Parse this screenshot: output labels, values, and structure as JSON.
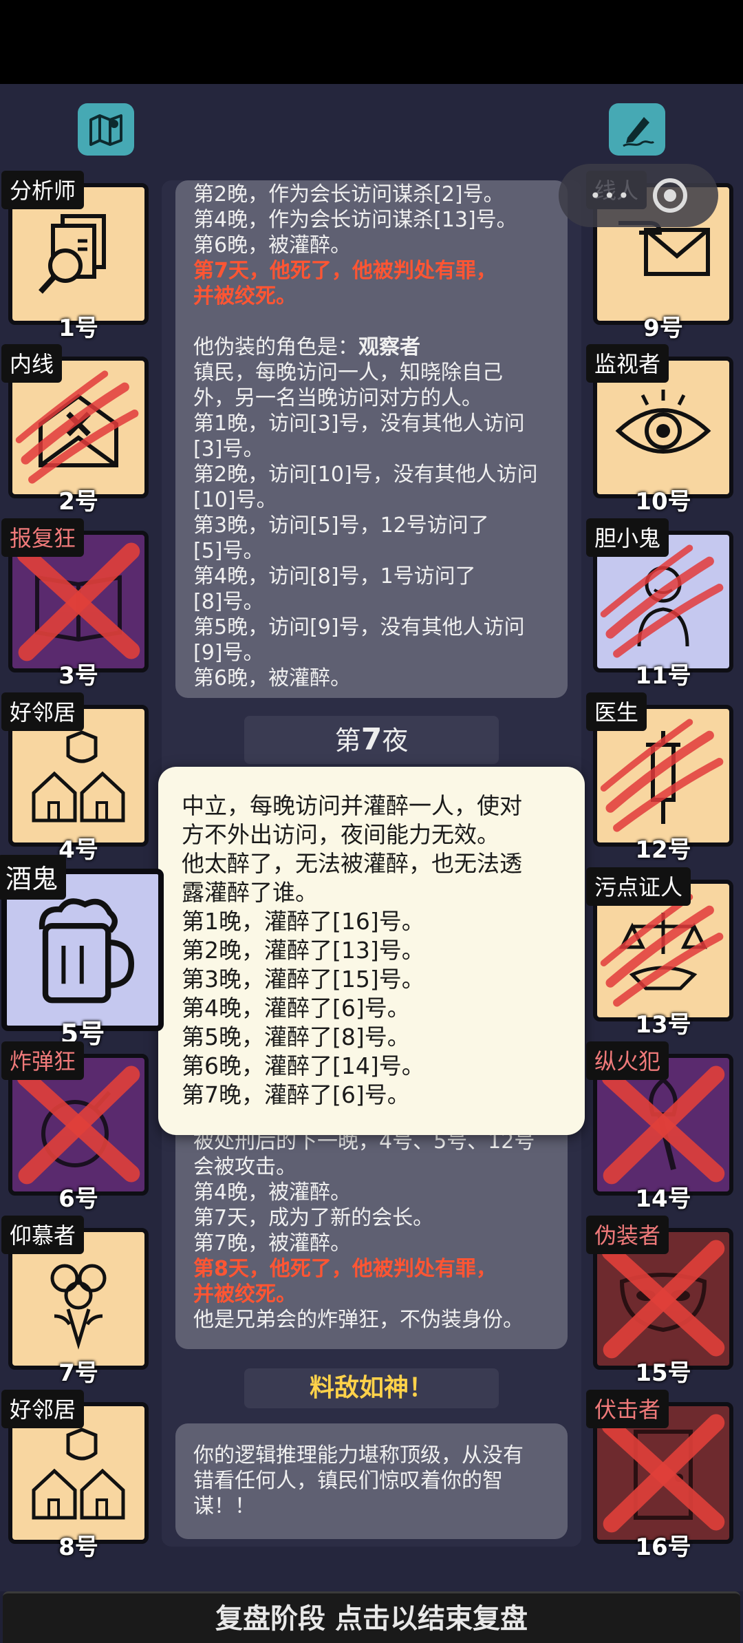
{
  "top_buttons": {
    "map_icon": "map-icon",
    "edit_icon": "notes-edit-icon"
  },
  "players": [
    {
      "num": "1号",
      "role": "分析师",
      "dead": false,
      "bg": "cream",
      "icon": "magnifier-documents-icon"
    },
    {
      "num": "2号",
      "role": "内线",
      "dead": false,
      "bg": "cream",
      "icon": "envelope-x-icon",
      "attacked": true
    },
    {
      "num": "3号",
      "role": "报复狂",
      "dead": true,
      "bg": "purple",
      "icon": "book-icon"
    },
    {
      "num": "4号",
      "role": "好邻居",
      "dead": false,
      "bg": "cream",
      "icon": "houses-shield-icon"
    },
    {
      "num": "5号",
      "role": "酒鬼",
      "dead": false,
      "bg": "lavender",
      "icon": "beer-mug-icon",
      "selected": true
    },
    {
      "num": "6号",
      "role": "炸弹狂",
      "dead": true,
      "bg": "purple",
      "icon": "bomb-icon"
    },
    {
      "num": "7号",
      "role": "仰慕者",
      "dead": false,
      "bg": "cream",
      "icon": "roses-icon"
    },
    {
      "num": "8号",
      "role": "好邻居",
      "dead": false,
      "bg": "cream",
      "icon": "houses-shield-icon"
    },
    {
      "num": "9号",
      "role": "线人",
      "dead": false,
      "bg": "cream",
      "icon": "hand-envelope-icon"
    },
    {
      "num": "10号",
      "role": "监视者",
      "dead": false,
      "bg": "cream",
      "icon": "eye-icon"
    },
    {
      "num": "11号",
      "role": "胆小鬼",
      "dead": false,
      "bg": "lavender",
      "icon": "scared-person-icon",
      "attacked": true
    },
    {
      "num": "12号",
      "role": "医生",
      "dead": false,
      "bg": "cream",
      "icon": "syringe-icon",
      "attacked": true
    },
    {
      "num": "13号",
      "role": "污点证人",
      "dead": false,
      "bg": "cream",
      "icon": "scales-handshake-icon",
      "attacked": true
    },
    {
      "num": "14号",
      "role": "纵火犯",
      "dead": true,
      "bg": "purple",
      "icon": "torch-icon"
    },
    {
      "num": "15号",
      "role": "伪装者",
      "dead": true,
      "bg": "maroon",
      "icon": "mask-icon"
    },
    {
      "num": "16号",
      "role": "伏击者",
      "dead": true,
      "bg": "maroon",
      "icon": "door-icon"
    }
  ],
  "pill": {
    "more_icon": "more-dots-icon",
    "close_icon": "target-close-icon"
  },
  "upper_log": {
    "lines": [
      {
        "text": "第2晚，作为会长访问谋杀[2]号。",
        "style": "normal"
      },
      {
        "text": "第4晚，作为会长访问谋杀[13]号。",
        "style": "normal"
      },
      {
        "text": "第6晚，被灌醉。",
        "style": "normal"
      },
      {
        "text": "第7天，他死了，他被判处有罪，",
        "style": "red"
      },
      {
        "text": "并被绞死。",
        "style": "red"
      },
      {
        "text": "",
        "style": "normal"
      },
      {
        "text": "他伪装的角色是：",
        "style": "normal",
        "bold_suffix": "观察者"
      },
      {
        "text": "镇民，每晚访问一人，知晓除自己",
        "style": "normal"
      },
      {
        "text": "外，另一名当晚访问对方的人。",
        "style": "normal"
      },
      {
        "text": "第1晚，访问[3]号，没有其他人访问",
        "style": "normal"
      },
      {
        "text": "[3]号。",
        "style": "normal"
      },
      {
        "text": "第2晚，访问[10]号，没有其他人访问",
        "style": "normal"
      },
      {
        "text": "[10]号。",
        "style": "normal"
      },
      {
        "text": "第3晚，访问[5]号，12号访问了",
        "style": "normal"
      },
      {
        "text": "[5]号。",
        "style": "normal"
      },
      {
        "text": "第4晚，访问[8]号，1号访问了",
        "style": "normal"
      },
      {
        "text": "[8]号。",
        "style": "normal"
      },
      {
        "text": "第5晚，访问[9]号，没有其他人访问",
        "style": "normal"
      },
      {
        "text": "[9]号。",
        "style": "normal"
      },
      {
        "text": "第6晚，被灌醉。",
        "style": "normal"
      }
    ]
  },
  "night_header": {
    "prefix": "第",
    "number": "7",
    "suffix": "夜"
  },
  "popup": {
    "lines": [
      "中立，每晚访问并灌醉一人，使对",
      "方不外出访问，夜间能力无效。",
      "他太醉了，无法被灌醉，也无法透",
      "露灌醉了谁。",
      "第1晚，灌醉了[16]号。",
      "第2晚，灌醉了[13]号。",
      "第3晚，灌醉了[15]号。",
      "第4晚，灌醉了[6]号。",
      "第5晚，灌醉了[8]号。",
      "第6晚，灌醉了[14]号。",
      "第7晚，灌醉了[6]号。"
    ]
  },
  "lower_log": {
    "lines": [
      {
        "text": "被处刑后的下一晚，4号、5号、12号",
        "style": "normal"
      },
      {
        "text": "会被攻击。",
        "style": "normal"
      },
      {
        "text": "第4晚，被灌醉。",
        "style": "normal"
      },
      {
        "text": "第7天，成为了新的会长。",
        "style": "normal"
      },
      {
        "text": "第7晚，被灌醉。",
        "style": "normal"
      },
      {
        "text": "第8天，他死了，他被判处有罪，",
        "style": "red"
      },
      {
        "text": "并被绞死。",
        "style": "red"
      },
      {
        "text": "他是兄弟会的炸弹狂，不伪装身份。",
        "style": "normal"
      }
    ]
  },
  "praise": {
    "title": "料敌如神！"
  },
  "summary": {
    "lines": [
      "你的逻辑推理能力堪称顶级，从没有",
      "错看任何人，镇民们惊叹着你的智",
      "谋！！"
    ]
  },
  "bottom_bar": {
    "label": "复盘阶段 点击以结束复盘"
  },
  "colors": {
    "cream": "#f8d6a0",
    "purple": "#5a2a6e",
    "lavender": "#c5c8ef",
    "maroon": "#6e2a2e",
    "red_text": "#ff5533",
    "gold_text": "#ffd24a"
  }
}
